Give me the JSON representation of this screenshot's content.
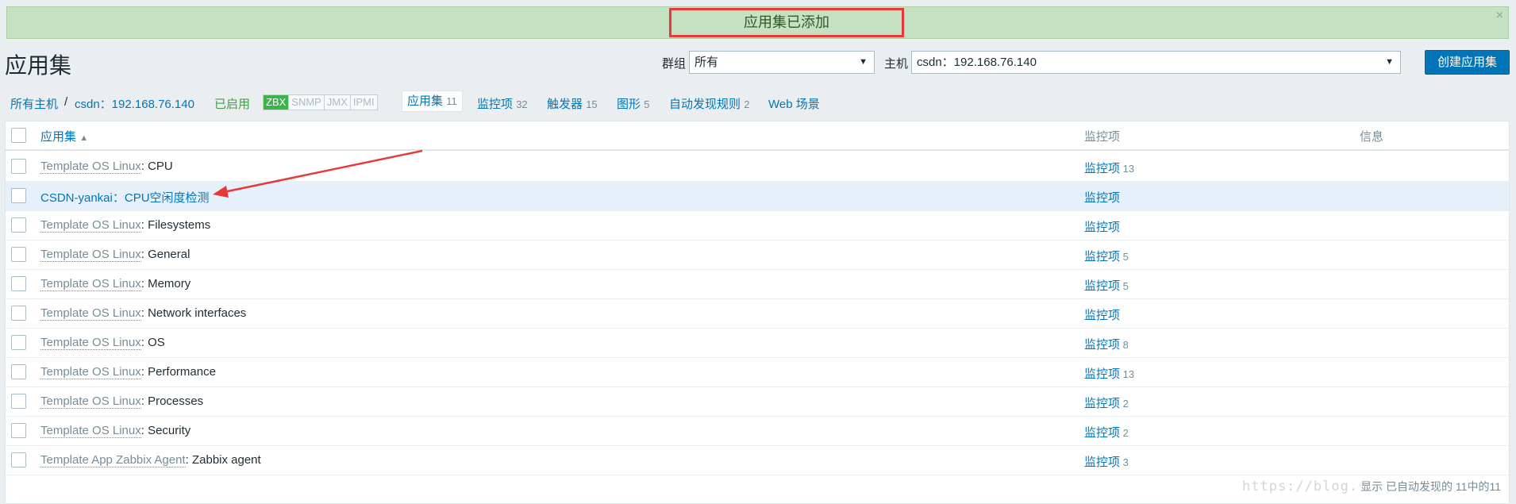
{
  "message": {
    "text": "应用集已添加",
    "close": "×"
  },
  "header": {
    "title": "应用集",
    "group_label": "群组",
    "group_value": "所有",
    "host_label": "主机",
    "host_value": "csdn：192.168.76.140",
    "create_button": "创建应用集"
  },
  "nav": {
    "all_hosts": "所有主机",
    "separator": "/",
    "host": "csdn：192.168.76.140",
    "status": "已启用",
    "tags": [
      "ZBX",
      "SNMP",
      "JMX",
      "IPMI"
    ],
    "applications_label": "应用集",
    "applications_count": "11",
    "items_label": "监控项",
    "items_count": "32",
    "triggers_label": "触发器",
    "triggers_count": "15",
    "graphs_label": "图形",
    "graphs_count": "5",
    "discovery_label": "自动发现规则",
    "discovery_count": "2",
    "web_label": "Web 场景"
  },
  "table": {
    "col_name": "应用集",
    "sort_indicator": "▲",
    "col_items": "监控项",
    "col_info": "信息",
    "rows": [
      {
        "template": "Template OS Linux",
        "sep": ": ",
        "name": "CPU",
        "items_label": "监控项",
        "items_count": "13"
      },
      {
        "template": "",
        "sep": "",
        "name": "CSDN-yankai：CPU空闲度检测",
        "items_label": "监控项",
        "items_count": ""
      },
      {
        "template": "Template OS Linux",
        "sep": ": ",
        "name": "Filesystems",
        "items_label": "监控项",
        "items_count": ""
      },
      {
        "template": "Template OS Linux",
        "sep": ": ",
        "name": "General",
        "items_label": "监控项",
        "items_count": "5"
      },
      {
        "template": "Template OS Linux",
        "sep": ": ",
        "name": "Memory",
        "items_label": "监控项",
        "items_count": "5"
      },
      {
        "template": "Template OS Linux",
        "sep": ": ",
        "name": "Network interfaces",
        "items_label": "监控项",
        "items_count": ""
      },
      {
        "template": "Template OS Linux",
        "sep": ": ",
        "name": "OS",
        "items_label": "监控项",
        "items_count": "8"
      },
      {
        "template": "Template OS Linux",
        "sep": ": ",
        "name": "Performance",
        "items_label": "监控项",
        "items_count": "13"
      },
      {
        "template": "Template OS Linux",
        "sep": ": ",
        "name": "Processes",
        "items_label": "监控项",
        "items_count": "2"
      },
      {
        "template": "Template OS Linux",
        "sep": ": ",
        "name": "Security",
        "items_label": "监控项",
        "items_count": "2"
      },
      {
        "template": "Template App Zabbix Agent",
        "sep": ": ",
        "name": "Zabbix agent",
        "items_label": "监控项",
        "items_count": "3"
      }
    ],
    "footer": "显示 已自动发现的 11中的11"
  },
  "watermark": "https://blog.",
  "colors": {
    "link": "#0275b8",
    "success_bg": "#c6e0c2",
    "annotation": "#e8393a",
    "enabled": "#429e47"
  }
}
